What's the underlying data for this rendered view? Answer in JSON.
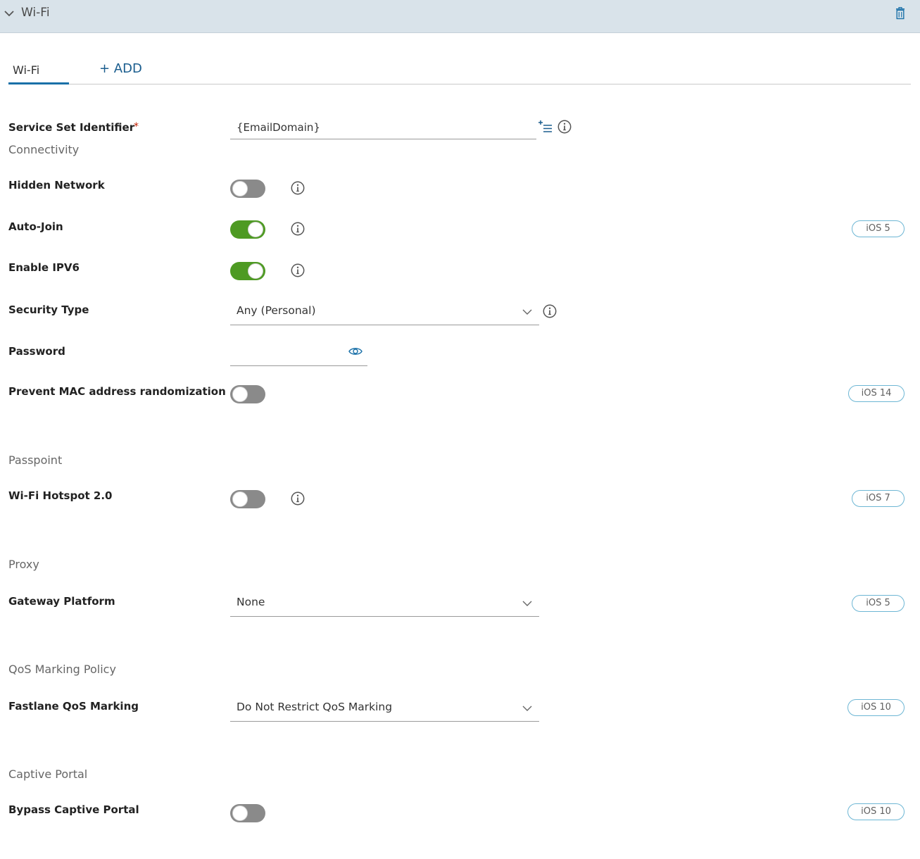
{
  "header": {
    "title": "Wi-Fi"
  },
  "tabs": {
    "active_label": "Wi-Fi",
    "add_label": "+ ADD"
  },
  "ssid": {
    "label": "Service Set Identifier",
    "required_marker": "*",
    "value": "{EmailDomain}"
  },
  "sections": {
    "connectivity": "Connectivity",
    "passpoint": "Passpoint",
    "proxy": "Proxy",
    "qos": "QoS Marking Policy",
    "captive": "Captive Portal"
  },
  "fields": {
    "hidden_network": {
      "label": "Hidden Network",
      "enabled": false
    },
    "auto_join": {
      "label": "Auto-Join",
      "enabled": true,
      "badge": "iOS 5"
    },
    "enable_ipv6": {
      "label": "Enable IPV6",
      "enabled": true
    },
    "security_type": {
      "label": "Security Type",
      "value": "Any (Personal)"
    },
    "password": {
      "label": "Password",
      "value": ""
    },
    "prevent_mac": {
      "label": "Prevent MAC address randomization",
      "enabled": false,
      "badge": "iOS 14"
    },
    "hotspot": {
      "label": "Wi-Fi Hotspot 2.0",
      "enabled": false,
      "badge": "iOS 7"
    },
    "gateway_platform": {
      "label": "Gateway Platform",
      "value": "None",
      "badge": "iOS 5"
    },
    "fastlane_qos": {
      "label": "Fastlane QoS Marking",
      "value": "Do Not Restrict QoS Marking",
      "badge": "iOS 10"
    },
    "bypass_captive": {
      "label": "Bypass Captive Portal",
      "enabled": false,
      "badge": "iOS 10"
    }
  },
  "colors": {
    "accent": "#1a70a8",
    "toggle_on": "#4e9a23",
    "toggle_off": "#8a8a8a",
    "header_bg": "#d9e3ea",
    "badge_border": "#6db6d4",
    "required": "#c21d00"
  },
  "icons": [
    "chevron-down-icon",
    "trash-icon",
    "lookup-list-icon",
    "info-icon",
    "eye-icon"
  ]
}
